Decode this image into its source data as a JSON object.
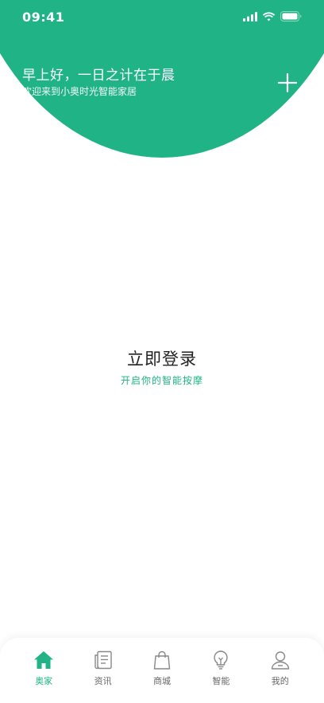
{
  "status_bar": {
    "time": "09:41"
  },
  "header": {
    "title": "早上好，一日之计在于晨",
    "subtitle": "欢迎来到小奥时光智能家居",
    "add_icon": "plus-icon"
  },
  "main": {
    "login_title": "立即登录",
    "login_subtitle": "开启你的智能按摩"
  },
  "tabbar": {
    "items": [
      {
        "label": "奥家",
        "icon": "home-icon",
        "active": true
      },
      {
        "label": "资讯",
        "icon": "news-icon",
        "active": false
      },
      {
        "label": "商城",
        "icon": "shopping-bag-icon",
        "active": false
      },
      {
        "label": "智能",
        "icon": "lightbulb-icon",
        "active": false
      },
      {
        "label": "我的",
        "icon": "profile-icon",
        "active": false
      }
    ]
  },
  "colors": {
    "accent": "#1fb385",
    "text_dark": "#222222",
    "text_muted": "#666666"
  }
}
